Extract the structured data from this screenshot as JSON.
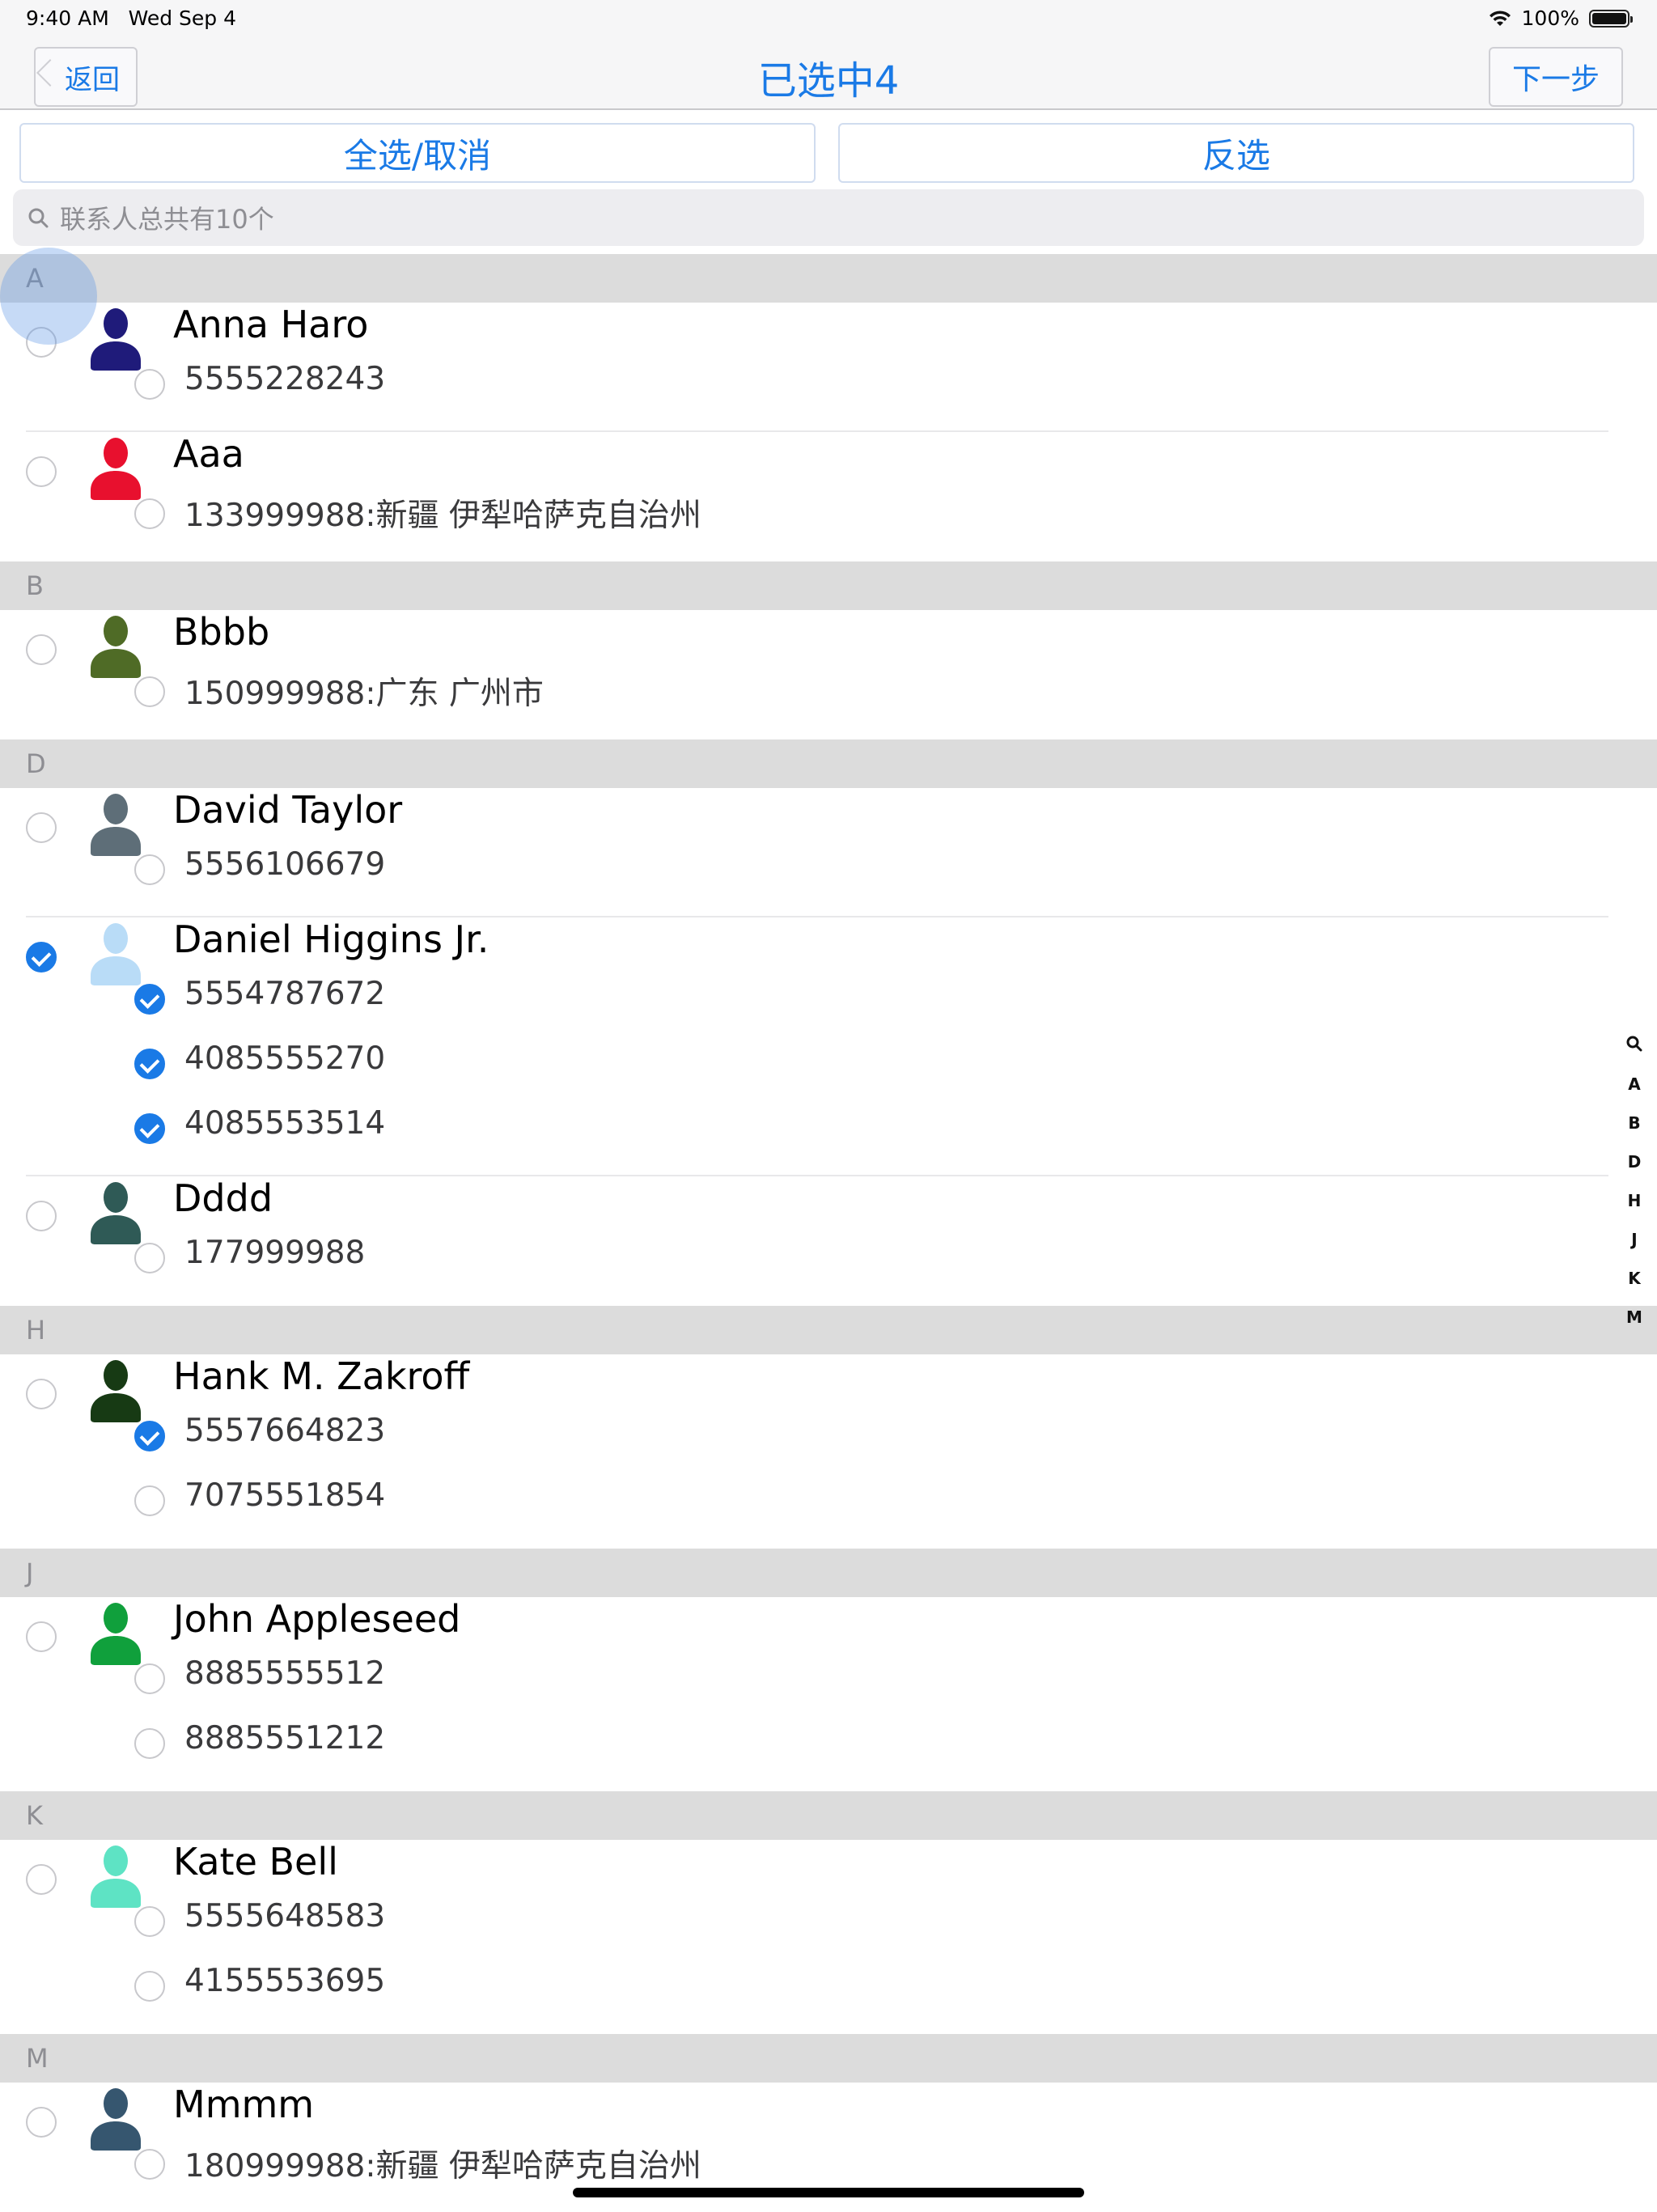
{
  "status_bar": {
    "time": "9:40 AM",
    "date": "Wed Sep 4",
    "battery": "100%"
  },
  "nav": {
    "back_label": "返回",
    "title": "已选中4",
    "next_label": "下一步"
  },
  "actions": {
    "select_all": "全选/取消",
    "invert": "反选"
  },
  "search": {
    "placeholder": "联系人总共有10个"
  },
  "accent_color": "#1a7ae6",
  "sections": [
    {
      "letter": "A",
      "contacts": [
        {
          "name": "Anna Haro",
          "avatar_color": "#1f1b7a",
          "selected": false,
          "phones": [
            {
              "number": "5555228243",
              "selected": false
            }
          ]
        },
        {
          "name": "Aaa",
          "avatar_color": "#e8102e",
          "selected": false,
          "phones": [
            {
              "number": "133999988:新疆 伊犁哈萨克自治州",
              "selected": false
            }
          ]
        }
      ]
    },
    {
      "letter": "B",
      "contacts": [
        {
          "name": "Bbbb",
          "avatar_color": "#4f6b26",
          "selected": false,
          "phones": [
            {
              "number": "150999988:广东 广州市",
              "selected": false
            }
          ]
        }
      ]
    },
    {
      "letter": "D",
      "contacts": [
        {
          "name": "David Taylor",
          "avatar_color": "#5e6e78",
          "selected": false,
          "phones": [
            {
              "number": "5556106679",
              "selected": false
            }
          ]
        },
        {
          "name": "Daniel Higgins Jr.",
          "avatar_color": "#b9dcf7",
          "selected": true,
          "phones": [
            {
              "number": "5554787672",
              "selected": true
            },
            {
              "number": "4085555270",
              "selected": true
            },
            {
              "number": "4085553514",
              "selected": true
            }
          ]
        },
        {
          "name": "Dddd",
          "avatar_color": "#2f5a56",
          "selected": false,
          "phones": [
            {
              "number": "177999988",
              "selected": false
            }
          ]
        }
      ]
    },
    {
      "letter": "H",
      "contacts": [
        {
          "name": "Hank M. Zakroff",
          "avatar_color": "#173a14",
          "selected": false,
          "phones": [
            {
              "number": "5557664823",
              "selected": true
            },
            {
              "number": "7075551854",
              "selected": false
            }
          ]
        }
      ]
    },
    {
      "letter": "J",
      "contacts": [
        {
          "name": "John Appleseed",
          "avatar_color": "#10a03c",
          "selected": false,
          "phones": [
            {
              "number": "8885555512",
              "selected": false
            },
            {
              "number": "8885551212",
              "selected": false
            }
          ]
        }
      ]
    },
    {
      "letter": "K",
      "contacts": [
        {
          "name": "Kate Bell",
          "avatar_color": "#5ee3c4",
          "selected": false,
          "phones": [
            {
              "number": "5555648583",
              "selected": false
            },
            {
              "number": "4155553695",
              "selected": false
            }
          ]
        }
      ]
    },
    {
      "letter": "M",
      "contacts": [
        {
          "name": "Mmmm",
          "avatar_color": "#36566f",
          "selected": false,
          "phones": [
            {
              "number": "180999988:新疆 伊犁哈萨克自治州",
              "selected": false
            }
          ]
        }
      ]
    }
  ],
  "index": [
    "search-icon",
    "A",
    "B",
    "D",
    "H",
    "J",
    "K",
    "M"
  ]
}
